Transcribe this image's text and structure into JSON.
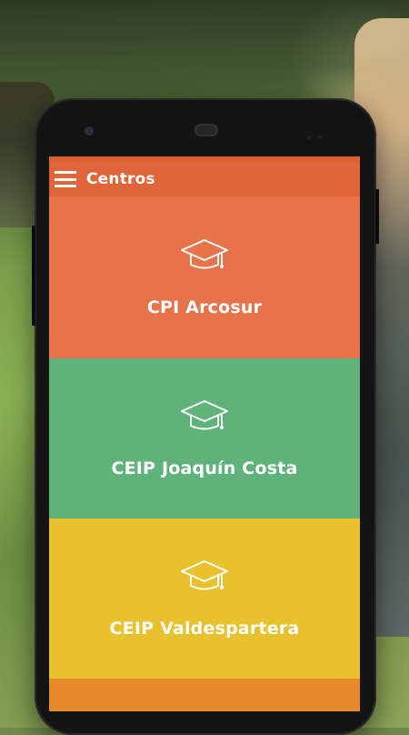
{
  "app": {
    "title": "Centros"
  },
  "centers": [
    {
      "name": "CPI Arcosur",
      "color": "#e6734a",
      "icon": "graduation-cap-icon"
    },
    {
      "name": "CEIP Joaquín Costa",
      "color": "#5fb37a",
      "icon": "graduation-cap-icon"
    },
    {
      "name": "CEIP Valdespartera",
      "color": "#e8c12c",
      "icon": "graduation-cap-icon"
    }
  ],
  "colors": {
    "appbar": "#e0653a",
    "statusbar": "#d9622e",
    "next_card": "#e6892b"
  },
  "icons": {
    "menu": "hamburger-menu-icon"
  }
}
